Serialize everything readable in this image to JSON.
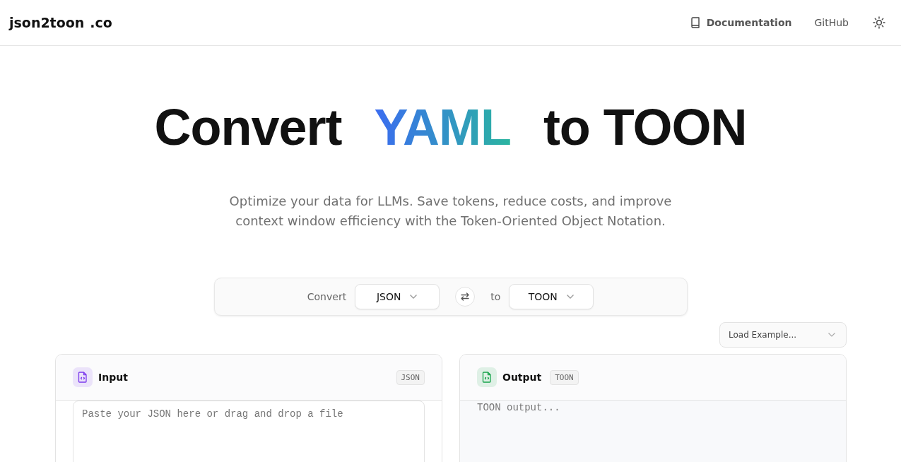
{
  "header": {
    "logo": {
      "name": "json2toon",
      "suffix": ".co"
    },
    "nav": [
      {
        "kind": "doc",
        "label": "Documentation"
      },
      {
        "kind": "plain",
        "label": "GitHub"
      }
    ]
  },
  "hero": {
    "title_start": "Convert",
    "title_highlight": "YAML",
    "title_end": "to TOON",
    "subtitle": "Optimize your data for LLMs. Save tokens, reduce costs, and improve context window efficiency with the Token-Oriented Object Notation."
  },
  "converter": {
    "label": "Convert",
    "from": "JSON",
    "to_label": "to",
    "to": "TOON"
  },
  "example_select": {
    "placeholder": "Load Example..."
  },
  "panels": [
    {
      "kind": "input",
      "title": "Input",
      "format": "JSON",
      "color": "#7c3aed",
      "placeholder": "Paste your JSON here or drag and drop a file"
    },
    {
      "kind": "output",
      "title": "Output",
      "format": "TOON",
      "color": "#16a34a",
      "placeholder": "TOON output..."
    }
  ]
}
